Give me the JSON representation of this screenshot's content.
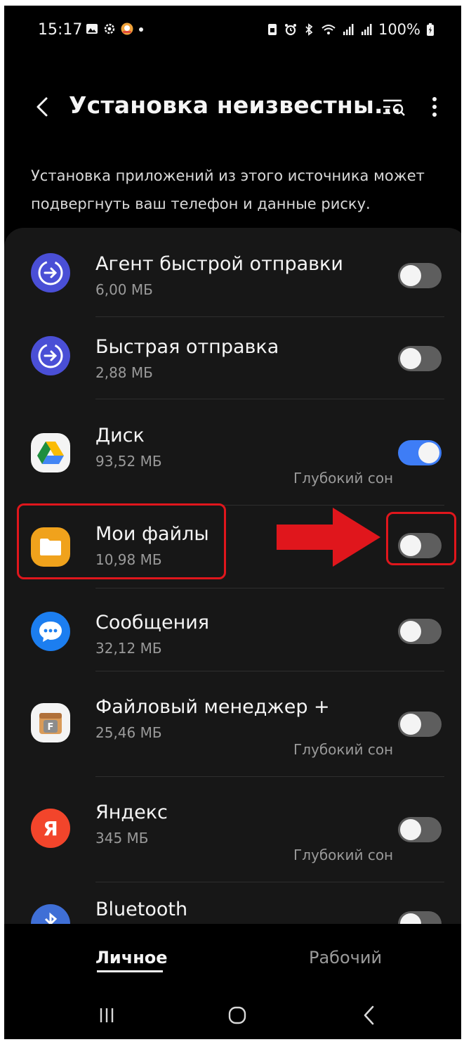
{
  "status_bar": {
    "time": "15:17",
    "battery": "100%",
    "left_icons": [
      "gallery-icon",
      "settings-icon",
      "app-badge-icon",
      "dot-icon"
    ],
    "right_icons": [
      "sim-icon",
      "alarm-icon",
      "bluetooth-icon",
      "wifi-icon",
      "signal-icon",
      "signal-icon",
      "battery-charging-icon"
    ]
  },
  "header": {
    "title": "Установка неизвестны...",
    "back_icon": "chevron-left-icon",
    "search_icon": "search-list-icon",
    "more_icon": "more-vertical-icon"
  },
  "warning_text": "Установка приложений из этого источника может подвергнуть ваш телефон и данные риску.",
  "apps": [
    {
      "name": "Агент быстрой отправки",
      "size": "6,00 МБ",
      "note": "",
      "enabled": false,
      "icon": "quick-share-icon"
    },
    {
      "name": "Быстрая отправка",
      "size": "2,88 МБ",
      "note": "",
      "enabled": false,
      "icon": "quick-share-icon"
    },
    {
      "name": "Диск",
      "size": "93,52 МБ",
      "note": "Глубокий сон",
      "enabled": true,
      "icon": "google-drive-icon"
    },
    {
      "name": "Мои файлы",
      "size": "10,98 МБ",
      "note": "",
      "enabled": false,
      "icon": "my-files-icon"
    },
    {
      "name": "Сообщения",
      "size": "32,12 МБ",
      "note": "",
      "enabled": false,
      "icon": "messages-icon"
    },
    {
      "name": "Файловый менеджер +",
      "size": "25,46 МБ",
      "note": "Глубокий сон",
      "enabled": false,
      "icon": "file-manager-icon"
    },
    {
      "name": "Яндекс",
      "size": "345 МБ",
      "note": "Глубокий сон",
      "enabled": false,
      "icon": "yandex-icon"
    },
    {
      "name": "Bluetooth",
      "size": "",
      "note": "",
      "enabled": false,
      "icon": "bluetooth-icon"
    }
  ],
  "tabs": {
    "personal": "Личное",
    "work": "Рабочий",
    "active": "personal"
  },
  "navbar": {
    "recents_icon": "recents-icon",
    "home_icon": "home-icon",
    "back_icon": "back-icon"
  },
  "colors": {
    "background": "#000000",
    "card": "#171717",
    "toggle_on": "#3e7df6",
    "toggle_off": "#5e5e5e",
    "annotation": "#e0161c"
  }
}
